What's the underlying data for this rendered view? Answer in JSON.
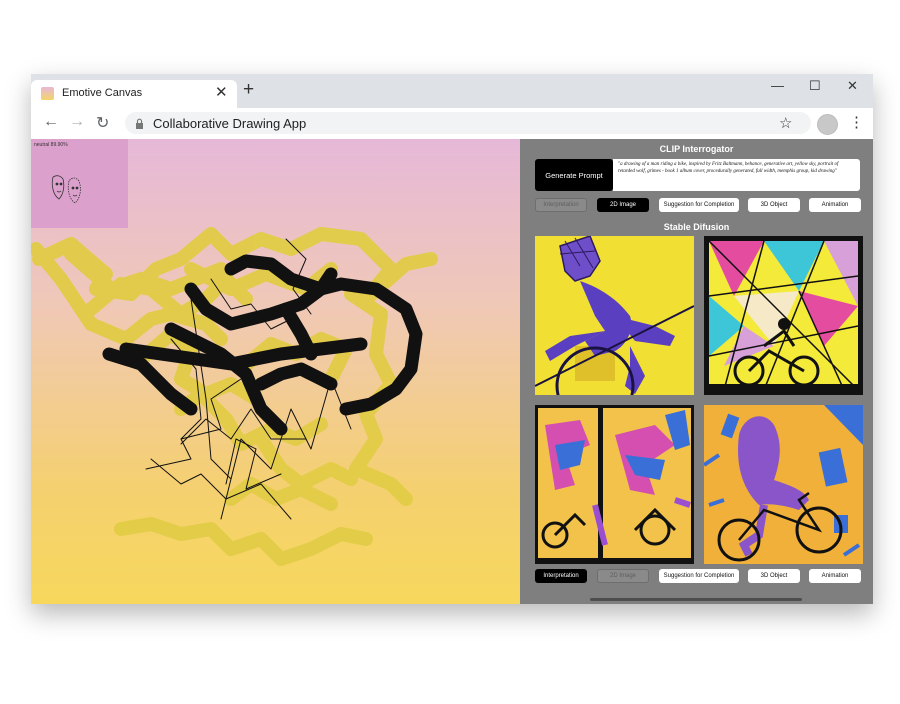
{
  "browser": {
    "tab_title": "Emotive Canvas",
    "url": "Collaborative Drawing App"
  },
  "canvas": {
    "emotion_label": "neutral 89.90%"
  },
  "clip": {
    "title": "CLIP Interrogator",
    "generate_label": "Generate Prompt",
    "prompt_text": "\"a drawing of a man riding a bike, inspired by Fritz Baltmann, behance, generative art, yellow sky, portrait of retarded wolf, grimes - book 1 album cover, procedurally generated, full width, memphis group, kid drawing\"",
    "tabs": [
      {
        "label": "Interpretation",
        "state": "disabled"
      },
      {
        "label": "2D Image",
        "state": "selected"
      },
      {
        "label": "Suggestion for Completion",
        "state": "normal"
      },
      {
        "label": "3D Object",
        "state": "normal"
      },
      {
        "label": "Animation",
        "state": "normal"
      }
    ]
  },
  "diffusion": {
    "title": "Stable Difusion",
    "images": [
      "generated-image-1",
      "generated-image-2",
      "generated-image-3",
      "generated-image-4"
    ],
    "tabs": [
      {
        "label": "Interpretation",
        "state": "selected"
      },
      {
        "label": "2D Image",
        "state": "disabled"
      },
      {
        "label": "Suggestion for Completion",
        "state": "normal"
      },
      {
        "label": "3D Object",
        "state": "normal"
      },
      {
        "label": "Animation",
        "state": "normal"
      }
    ]
  },
  "colors": {
    "canvas_top": "#e6b8d8",
    "canvas_bottom": "#f7d85c",
    "panel_bg": "#7f7f7f",
    "stroke_yellow": "#e4cf48",
    "stroke_black": "#111111"
  }
}
